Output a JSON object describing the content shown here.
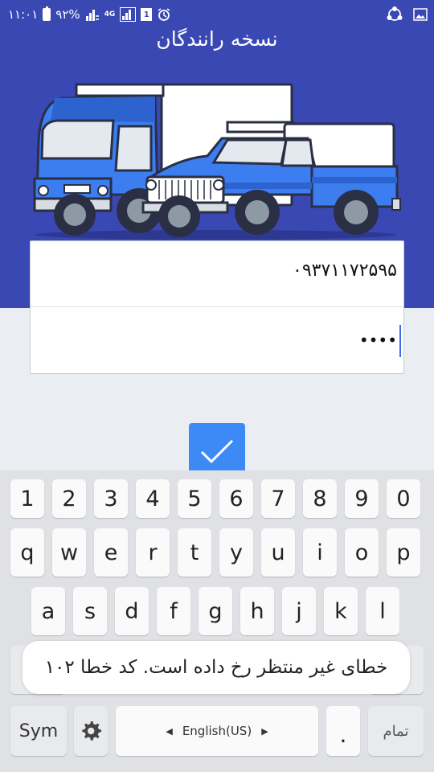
{
  "status_bar": {
    "time": "۱۱:۰۱",
    "battery_percent": "۹۲%",
    "network_label": "4G",
    "sim_number": "1",
    "icons": [
      "battery-icon",
      "signal-icon",
      "lte-signal-icon",
      "sim-icon",
      "alarm-icon",
      "sync-icon",
      "image-icon"
    ]
  },
  "header": {
    "title": "نسخه رانندگان",
    "illustration": "truck-and-pickup-illustration",
    "background_color": "#3a48b4"
  },
  "form": {
    "phone_value": "۰۹۳۷۱۱۷۲۵۹۵",
    "password_masked": "••••"
  },
  "confirm_button": {
    "icon": "checkmark-icon",
    "color": "#3d8af7"
  },
  "keyboard": {
    "row_numbers": [
      "1",
      "2",
      "3",
      "4",
      "5",
      "6",
      "7",
      "8",
      "9",
      "0"
    ],
    "row_top": [
      "q",
      "w",
      "e",
      "r",
      "t",
      "y",
      "u",
      "i",
      "o",
      "p"
    ],
    "row_middle": [
      "a",
      "s",
      "d",
      "f",
      "g",
      "h",
      "j",
      "k",
      "l"
    ],
    "sym_label": "Sym",
    "settings_icon": "gear-icon",
    "space_label": "English(US)",
    "dot_label": ".",
    "done_label": "تمام"
  },
  "toast": {
    "message": "خطای غیر منتظر رخ داده است. کد خطا ۱۰۲"
  }
}
